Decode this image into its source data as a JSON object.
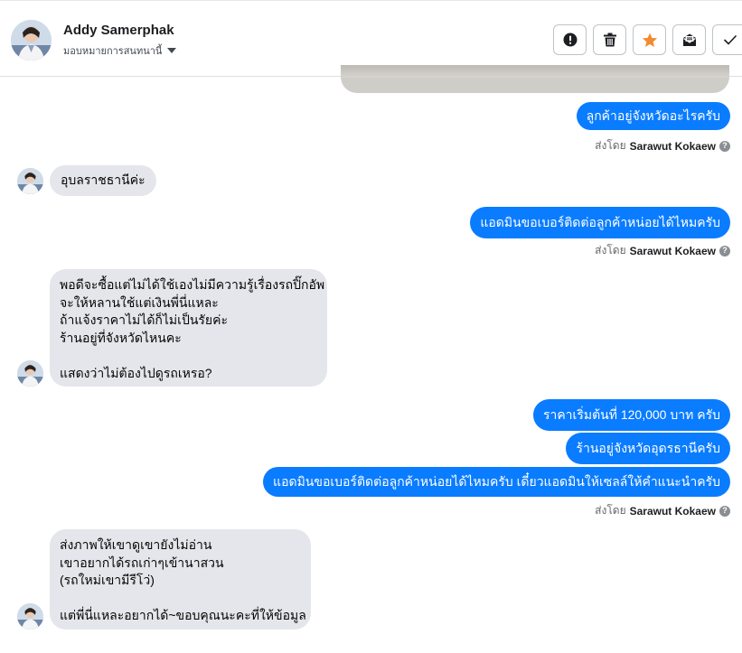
{
  "header": {
    "name": "Addy Samerphak",
    "assign_label": "มอบหมายการสนทนานี้"
  },
  "toolbar": {
    "items": [
      "alert-icon",
      "trash-icon",
      "star-icon",
      "mark-unread-icon",
      "check-icon"
    ],
    "star_color": "#f28b30"
  },
  "colors": {
    "outgoing": "#0a7cff",
    "incoming": "#e4e6eb"
  },
  "messages": {
    "m1": "ลูกค้าอยู่จังหวัดอะไรครับ",
    "m2": "อุบลราชธานีค่ะ",
    "m3": "แอดมินขอเบอร์ติดต่อลูกค้าหน่อยได้ไหมครับ",
    "m4": "พอดีจะซื้อแต่ไม่ได้ใช้เองไม่มีความรู้เรื่องรถปิ๊กอัพ\nจะให้หลานใช้แต่เงินพี่นี่แหละ\nถ้าแจ้งราคาไม่ได้ก็ไม่เป็นรัยค่ะ\nร้านอยู่ที่จังหวัดไหนคะ\n\nแสดงว่าไม่ต้องไปดูรถเหรอ?",
    "m5": "ราคาเริ่มต้นที่ 120,000 บาท ครับ",
    "m6": "ร้านอยู่จังหวัดอุดรธานีครับ",
    "m7": "แอดมินขอเบอร์ติดต่อลูกค้าหน่อยได้ไหมครับ เดี๋ยวแอดมินให้เซลล์ให้คำแนะนำครับ",
    "m8": "ส่งภาพให้เขาดูเขายังไม่อ่าน\nเขาอยากได้รถเก่าๆเข้านาสวน\n(รถใหม่เขามีรีโว่)\n\nแต่พี่นี่แหละอยากได้~ขอบคุณนะคะที่ให้ข้อมูล"
  },
  "sent_by": {
    "prefix": "ส่งโดย",
    "name": "Sarawut Kokaew"
  }
}
